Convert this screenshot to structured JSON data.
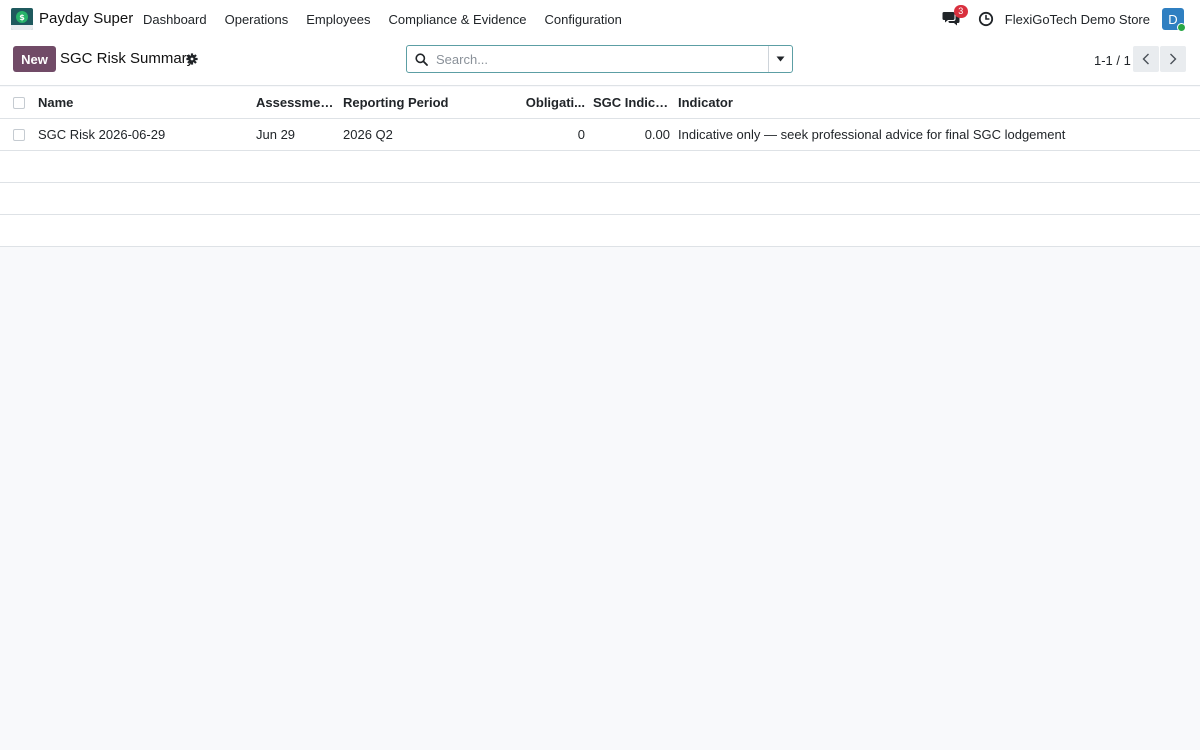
{
  "app": {
    "name": "Payday Super",
    "logo_glyph": "$"
  },
  "nav": {
    "items": [
      "Dashboard",
      "Operations",
      "Employees",
      "Compliance & Evidence",
      "Configuration"
    ]
  },
  "systray": {
    "messages_count": "3",
    "company": "FlexiGoTech Demo Store",
    "avatar_initial": "D"
  },
  "control": {
    "new_label": "New",
    "title": "SGC Risk Summary",
    "search_placeholder": "Search...",
    "pager": "1-1 / 1"
  },
  "table": {
    "columns": {
      "name": "Name",
      "assessment": "Assessment...",
      "period": "Reporting Period",
      "obligations": "Obligati...",
      "sgc_indicator": "SGC Indicat...",
      "indicator": "Indicator"
    },
    "rows": [
      {
        "name": "SGC Risk 2026-06-29",
        "assessment": "Jun 29",
        "period": "2026 Q2",
        "obligations": "0",
        "sgc_indicator": "0.00",
        "indicator": "Indicative only — seek professional advice for final SGC lodgement"
      }
    ]
  },
  "colors": {
    "primary": "#714b67",
    "search_border": "#5c9ea4",
    "badge": "#d9303e",
    "avatar": "#2f7fc1"
  }
}
